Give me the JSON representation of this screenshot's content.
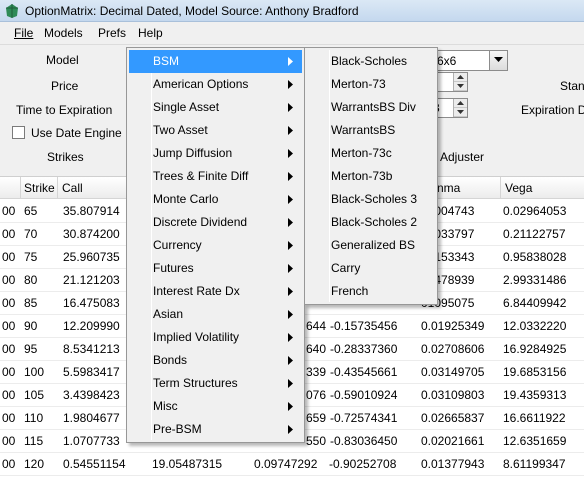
{
  "window": {
    "title": "OptionMatrix: Decimal Dated, Model Source: Anthony Bradford"
  },
  "menubar": [
    {
      "label": "File"
    },
    {
      "label": "Models"
    },
    {
      "label": "Prefs"
    },
    {
      "label": "Help"
    }
  ],
  "form": {
    "model_label": "Model",
    "price_label": "Price",
    "tte_label": "Time to Expiration",
    "use_date_engine_label": "Use Date Engine",
    "strikes_label": "Strikes",
    "combo_value": "6x6",
    "spin_value": "3",
    "stan_label": "Stan",
    "expiration_label": "Expiration D",
    "adjuster_label": "Adjuster"
  },
  "grid": {
    "columns": [
      "Strike",
      "Call",
      "",
      "",
      "nma",
      "Vega"
    ],
    "rows": [
      {
        "c0": "00",
        "strike": "65",
        "call": "35.807914",
        "g": "",
        "d": "",
        "gm": "00004743",
        "vega": "0.02964053"
      },
      {
        "c0": "00",
        "strike": "70",
        "call": "30.874200",
        "g": "",
        "d": "",
        "gm": "00033797",
        "vega": "0.21122757"
      },
      {
        "c0": "00",
        "strike": "75",
        "call": "25.960735",
        "g": "",
        "d": "",
        "gm": "00153343",
        "vega": "0.95838028"
      },
      {
        "c0": "00",
        "strike": "80",
        "call": "21.121203",
        "g": "",
        "d": "",
        "gm": "00478939",
        "vega": "2.99331486"
      },
      {
        "c0": "00",
        "strike": "85",
        "call": "16.475083",
        "g": "",
        "d": "",
        "gm": "01095075",
        "vega": "6.84409942"
      },
      {
        "c0": "00",
        "strike": "90",
        "call": "12.209990",
        "g": "644",
        "d": "-0.15735456",
        "gm": "0.01925349",
        "vega": "12.0332220"
      },
      {
        "c0": "00",
        "strike": "95",
        "call": "8.5341213",
        "g": "640",
        "d": "-0.28337360",
        "gm": "0.02708606",
        "vega": "16.9284925"
      },
      {
        "c0": "00",
        "strike": "100",
        "call": "5.5983417",
        "g": "339",
        "d": "-0.43545661",
        "gm": "0.03149705",
        "vega": "19.6853156"
      },
      {
        "c0": "00",
        "strike": "105",
        "call": "3.4398423",
        "g": "076",
        "d": "-0.59010924",
        "gm": "0.03109803",
        "vega": "19.4359313"
      },
      {
        "c0": "00",
        "strike": "110",
        "call": "1.9804677",
        "g": "659",
        "d": "-0.72574341",
        "gm": "0.02665837",
        "vega": "16.6611922"
      },
      {
        "c0": "00",
        "strike": "115",
        "call": "1.0707733",
        "g": "550",
        "d": "-0.83036450",
        "gm": "0.02021661",
        "vega": "12.6351659"
      },
      {
        "c0": "00",
        "strike": "120",
        "call": "0.54551154",
        "g": "19.05487315",
        "d2": "0.09747292",
        "d": "-0.90252708",
        "gm": "0.01377943",
        "vega": "8.61199347"
      }
    ]
  },
  "models_menu": [
    {
      "label": "BSM",
      "highlighted": true
    },
    {
      "label": "American Options"
    },
    {
      "label": "Single Asset"
    },
    {
      "label": "Two Asset"
    },
    {
      "label": "Jump Diffusion"
    },
    {
      "label": "Trees & Finite Diff"
    },
    {
      "label": "Monte Carlo"
    },
    {
      "label": "Discrete Dividend"
    },
    {
      "label": "Currency"
    },
    {
      "label": "Futures"
    },
    {
      "label": "Interest Rate Dx"
    },
    {
      "label": "Asian"
    },
    {
      "label": "Implied Volatility"
    },
    {
      "label": "Bonds"
    },
    {
      "label": "Term Structures"
    },
    {
      "label": "Misc"
    },
    {
      "label": "Pre-BSM"
    }
  ],
  "bsm_submenu": [
    {
      "label": "Black-Scholes"
    },
    {
      "label": "Merton-73"
    },
    {
      "label": "WarrantsBS Div"
    },
    {
      "label": "WarrantsBS"
    },
    {
      "label": "Merton-73c"
    },
    {
      "label": "Merton-73b"
    },
    {
      "label": "Black-Scholes 3"
    },
    {
      "label": "Black-Scholes 2"
    },
    {
      "label": "Generalized BS"
    },
    {
      "label": "Carry"
    },
    {
      "label": "French"
    }
  ],
  "colors": {
    "highlight": "#3399ff",
    "menu_bg": "#f0f0f0",
    "titlebar": "#c4d8ee"
  }
}
